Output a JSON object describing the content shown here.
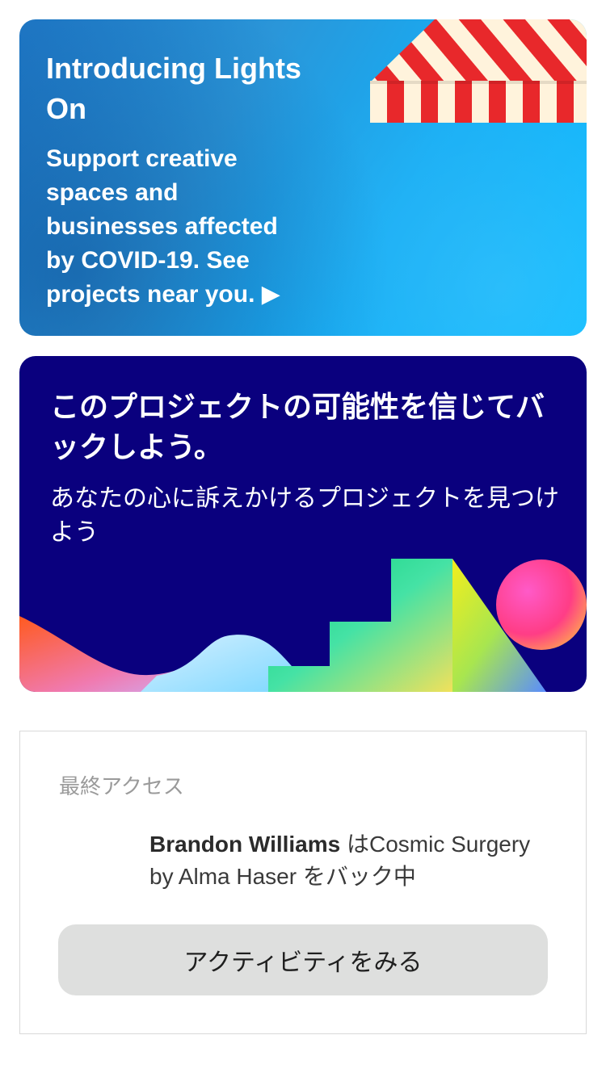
{
  "banner_lights_on": {
    "title": "Introducing Lights On",
    "body": "Support creative spaces and businesses affected by COVID-19. See projects near you.",
    "arrow": "▶"
  },
  "banner_back_project": {
    "title": "このプロジェクトの可能性を信じてバックしよう。",
    "subtitle": "あなたの心に訴えかけるプロジェクトを見つけよう"
  },
  "last_access": {
    "label": "最終アクセス",
    "user_name": "Brandon Williams",
    "activity_rest": " はCosmic Surgery by Alma Haser をバック中",
    "button_label": "アクティビティをみる"
  },
  "colors": {
    "awning_red": "#e8282b",
    "awning_cream": "#fff3dc",
    "card2_bg": "#0a007e"
  }
}
